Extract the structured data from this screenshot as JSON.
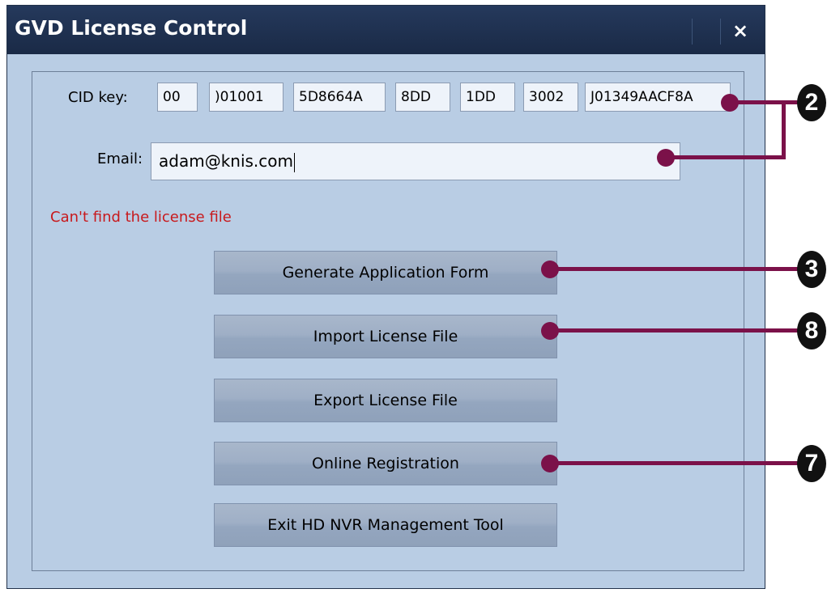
{
  "window": {
    "title": "GVD License Control",
    "close_glyph": "×"
  },
  "form": {
    "cid_label": "CID key:",
    "cid_fields": [
      "00",
      ")01001",
      "5D8664A",
      "8DD",
      "1DD",
      "3002",
      "J01349AACF8A"
    ],
    "email_label": "Email:",
    "email_value": "adam@knis.com",
    "error_text": "Can't find the license file"
  },
  "buttons": {
    "generate": "Generate Application Form",
    "import": "Import License File",
    "export": "Export License File",
    "online": "Online Registration",
    "exit": "Exit HD NVR Management Tool"
  },
  "callouts": {
    "fields": "2",
    "generate": "3",
    "import": "8",
    "online": "7"
  },
  "colors": {
    "titlebar": "#1f3152",
    "window_bg": "#b9cde4",
    "error": "#c8191c",
    "callout_line": "#7b1149"
  }
}
